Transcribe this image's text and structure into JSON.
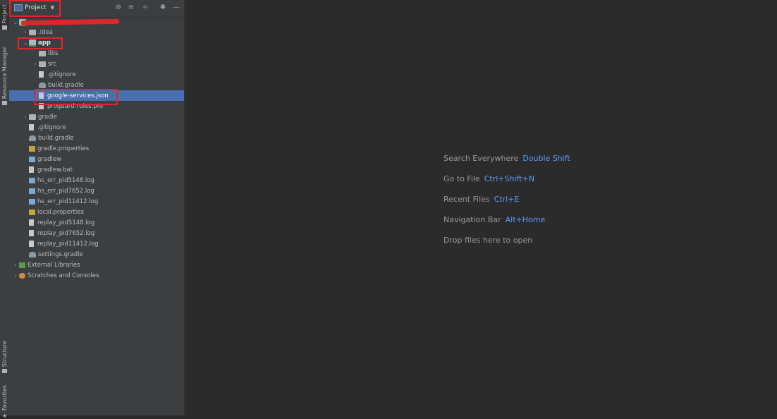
{
  "left_strip": {
    "tabs": [
      {
        "label": "Project"
      },
      {
        "label": "Resource Manager"
      },
      {
        "label": "Structure"
      },
      {
        "label": "Favorites"
      }
    ]
  },
  "panel": {
    "view_selector": "Project",
    "header_icons": [
      "globe-icon",
      "expand-all-icon",
      "collapse-all-icon",
      "gear-icon",
      "minimize-icon"
    ]
  },
  "tree": [
    {
      "label": "app",
      "bold": true,
      "expanded": true
    },
    {
      "label": ".idea"
    },
    {
      "label": "app"
    },
    {
      "label": "libs"
    },
    {
      "label": "src"
    },
    {
      "label": ".gitignore"
    },
    {
      "label": "build.gradle"
    },
    {
      "label": "google-services.json",
      "selected": true
    },
    {
      "label": "proguard-rules.pro"
    },
    {
      "label": "gradle"
    },
    {
      "label": ".gitignore"
    },
    {
      "label": "build.gradle"
    },
    {
      "label": "gradle.properties"
    },
    {
      "label": "gradlew"
    },
    {
      "label": "gradlew.bat"
    },
    {
      "label": "hs_err_pid5148.log"
    },
    {
      "label": "hs_err_pid7652.log"
    },
    {
      "label": "hs_err_pid11412.log"
    },
    {
      "label": "local.properties"
    },
    {
      "label": "replay_pid5148.log"
    },
    {
      "label": "replay_pid7652.log"
    },
    {
      "label": "replay_pid11412.log"
    },
    {
      "label": "settings.gradle"
    },
    {
      "label": "External Libraries"
    },
    {
      "label": "Scratches and Consoles"
    }
  ],
  "editor": {
    "hints": [
      {
        "text": "Search Everywhere",
        "key": "Double Shift"
      },
      {
        "text": "Go to File",
        "key": "Ctrl+Shift+N"
      },
      {
        "text": "Recent Files",
        "key": "Ctrl+E"
      },
      {
        "text": "Navigation Bar",
        "key": "Alt+Home"
      },
      {
        "text": "Drop files here to open",
        "key": ""
      }
    ]
  },
  "colors": {
    "selection": "#4b6eaf",
    "annotation_red": "#e0262b",
    "hint_key": "#589df6"
  }
}
